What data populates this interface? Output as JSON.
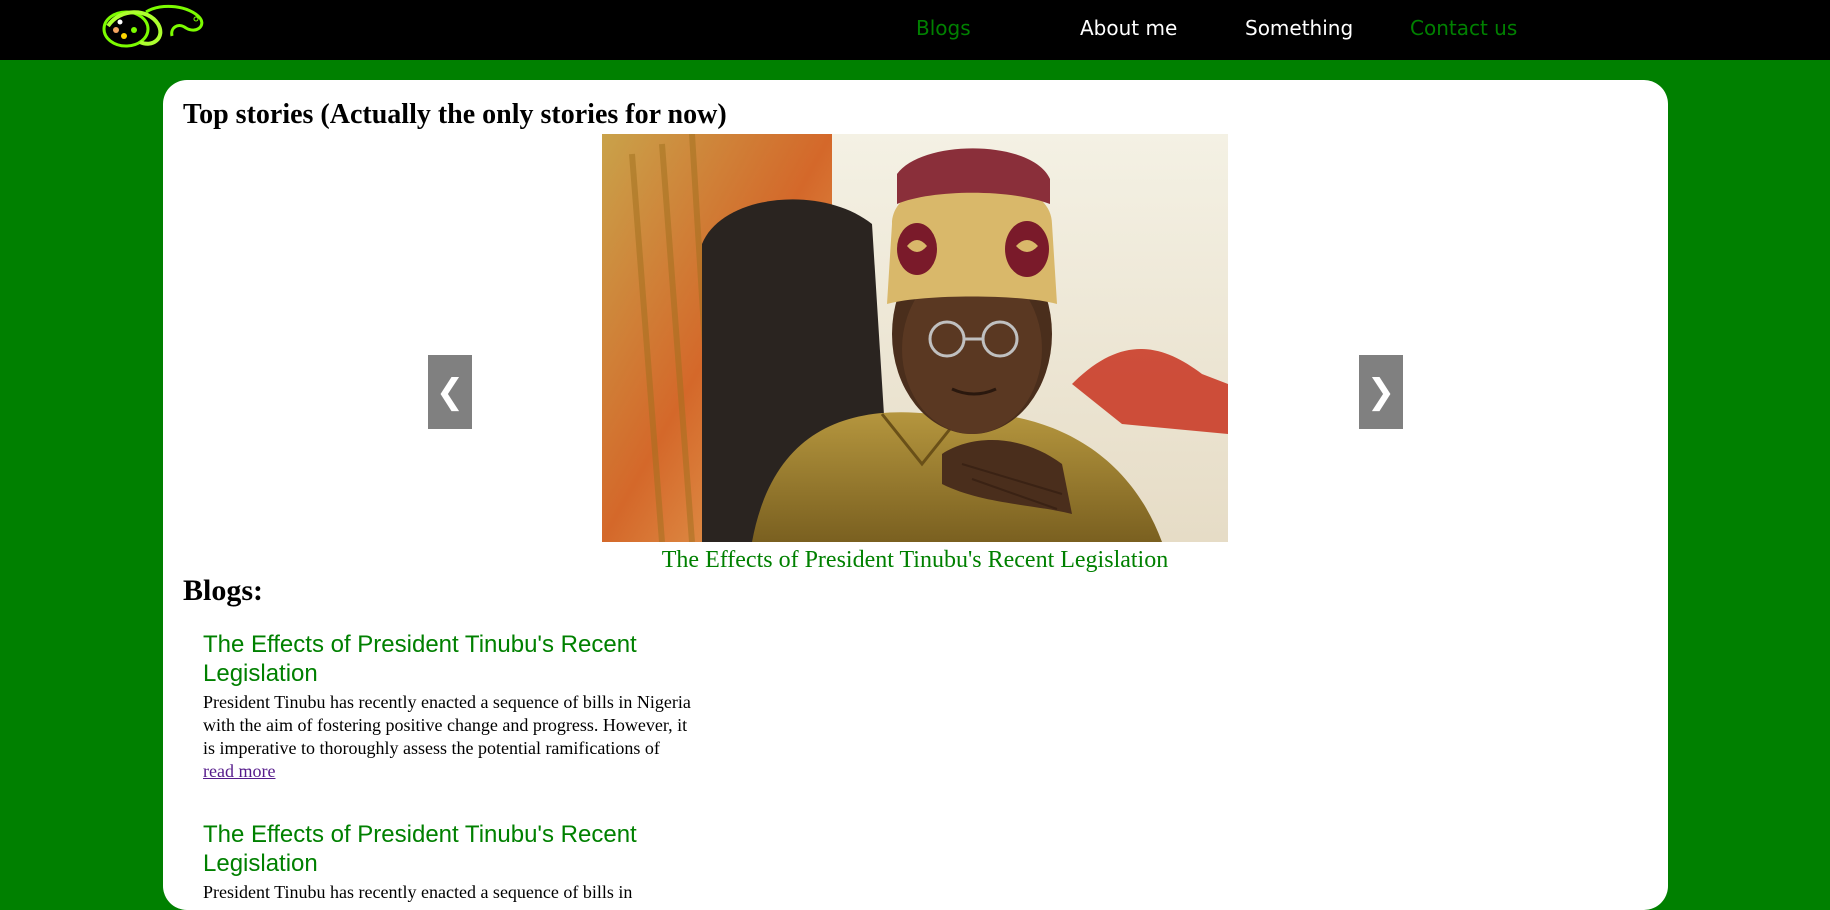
{
  "nav": {
    "logo_icon": "snake-logo-icon",
    "items": [
      {
        "label": "Blogs",
        "color": "#008000"
      },
      {
        "label": "About me",
        "color": "#ffffff"
      },
      {
        "label": "Something",
        "color": "#ffffff"
      },
      {
        "label": "Contact us",
        "color": "#008000"
      }
    ]
  },
  "main": {
    "section_title": "Top stories (Actually the only stories for now)",
    "slideshow": {
      "prev_label": "❮",
      "next_label": "❯",
      "caption": "The Effects of President Tinubu's Recent Legislation"
    },
    "blogs_heading": "Blogs:",
    "blogs": [
      {
        "title": "The Effects of President Tinubu's Recent Legislation",
        "excerpt": "President Tinubu has recently enacted a sequence of bills in Nigeria with the aim of fostering positive change and progress. However, it is imperative to thoroughly assess the potential ramifications of",
        "read_more": "read more"
      },
      {
        "title": "The Effects of President Tinubu's Recent Legislation",
        "excerpt": "President Tinubu has recently enacted a sequence of bills in"
      }
    ]
  },
  "colors": {
    "background": "#008000",
    "topbar": "#000000",
    "accent_green": "#008000",
    "arrow_bg": "#808080"
  }
}
